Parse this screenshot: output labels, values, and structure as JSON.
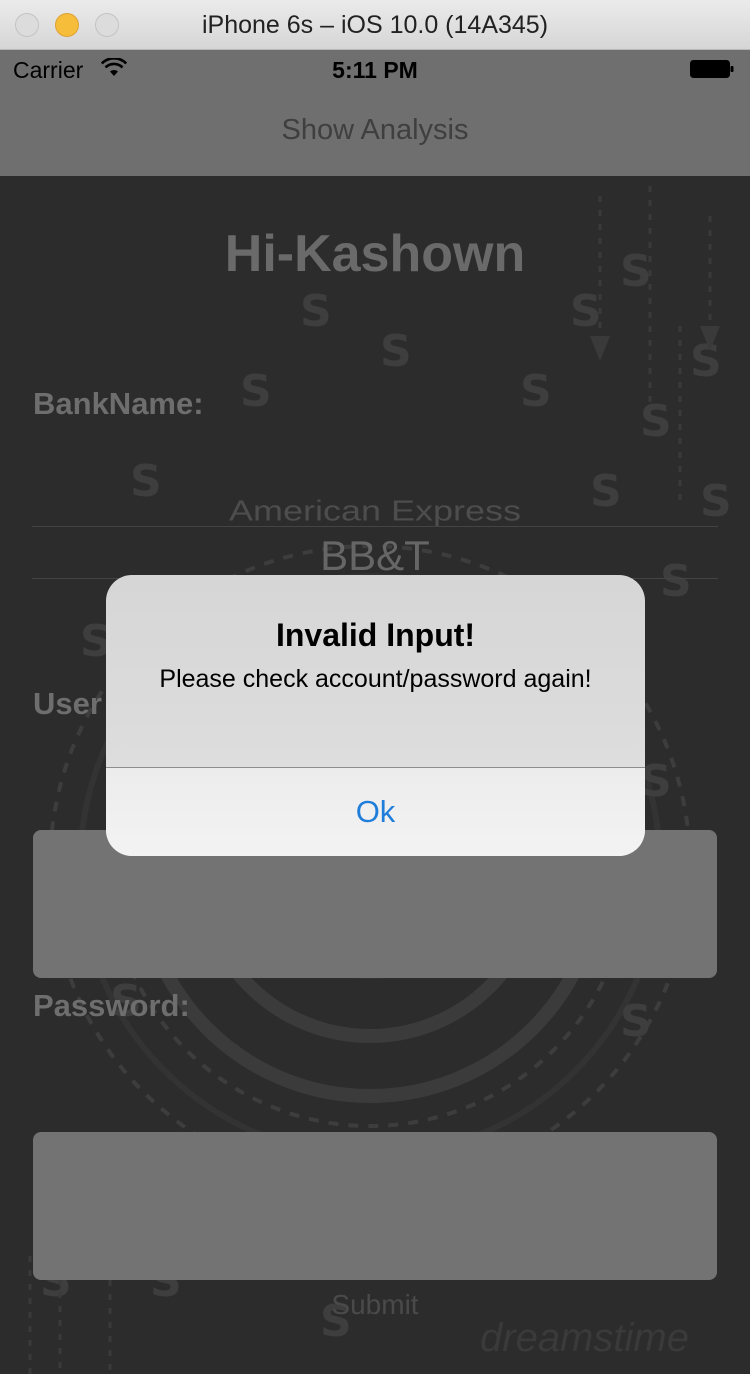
{
  "window": {
    "title": "iPhone 6s – iOS 10.0 (14A345)"
  },
  "statusbar": {
    "carrier": "Carrier",
    "time": "5:11 PM"
  },
  "navbar": {
    "title": "Show Analysis"
  },
  "app": {
    "title": "Hi-Kashown",
    "bank_label": "BankName:",
    "bank_picker": {
      "previous_option": "American Express",
      "selected_option": "BB&T"
    },
    "username_label": "User",
    "username_value": "",
    "password_label": "Password:",
    "password_value": "",
    "submit_label": "Submit",
    "watermark": "dreamstime"
  },
  "alert": {
    "title": "Invalid Input!",
    "message": "Please check account/password again!",
    "ok_label": "Ok"
  },
  "colors": {
    "alert_button_text": "#1f7ddb",
    "dimmed_background": "#2c2c2c"
  }
}
